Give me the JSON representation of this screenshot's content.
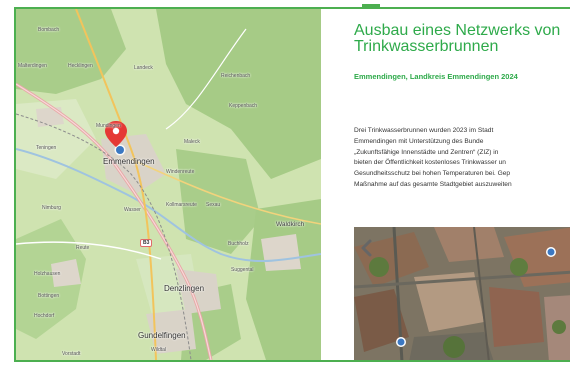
{
  "project": {
    "title": "Ausbau eines Netzwerks von Trinkwasserbrunnen",
    "subtitle": "Emmendingen, Landkreis Emmendingen 2024",
    "description_lines": [
      "Drei Trinkwasserbrunnen wurden 2023 im Stadt",
      "Emmendingen mit Unterstützung des Bunde",
      "„Zukunftsfähige Innenstädte und Zentren“ (ZIZ) in",
      "bieten der Öffentlichkeit kostenloses Trinkwasser un",
      "Gesundheitsschutz bei hohen Temperaturen bei. Gep",
      "Maßnahme auf das gesamte Stadtgebiet auszuweiten"
    ]
  },
  "map": {
    "labels": {
      "bombach": "Bombach",
      "malterdingen": "Malterdingen",
      "hecklingen": "Hecklingen",
      "landeck": "Landeck",
      "reichenbach": "Reichenbach",
      "keppenbach": "Keppenbach",
      "maleck": "Maleck",
      "teningen": "Teningen",
      "mundingen": "Mundingen",
      "emmendingen": "Emmendingen",
      "windenreute": "Windenreute",
      "kollmarsreute": "Kollmarsreute",
      "sexau": "Sexau",
      "nimburg": "Nimburg",
      "wasser": "Wasser",
      "waldkirch": "Waldkirch",
      "reute": "Reute",
      "buchholz": "Buchholz",
      "holzhausen": "Holzhausen",
      "denzlingen": "Denzlingen",
      "suggental": "Suggental",
      "bottingen": "Bottingen",
      "hochdorf": "Hochdorf",
      "gundelfingen": "Gundelfingen",
      "wildtal": "Wildtal",
      "vorstadt": "Vorstadt"
    },
    "road_badge": "B3",
    "marker_icon": "map-pin-icon",
    "location_icon": "current-location-icon"
  },
  "gallery": {
    "prev_icon": "chevron-left-icon",
    "fountain_icon": "water-tap-icon"
  },
  "colors": {
    "accent": "#2eaa4a",
    "frame": "#4caf50",
    "marker": "#e53935",
    "location": "#3b78c2"
  }
}
